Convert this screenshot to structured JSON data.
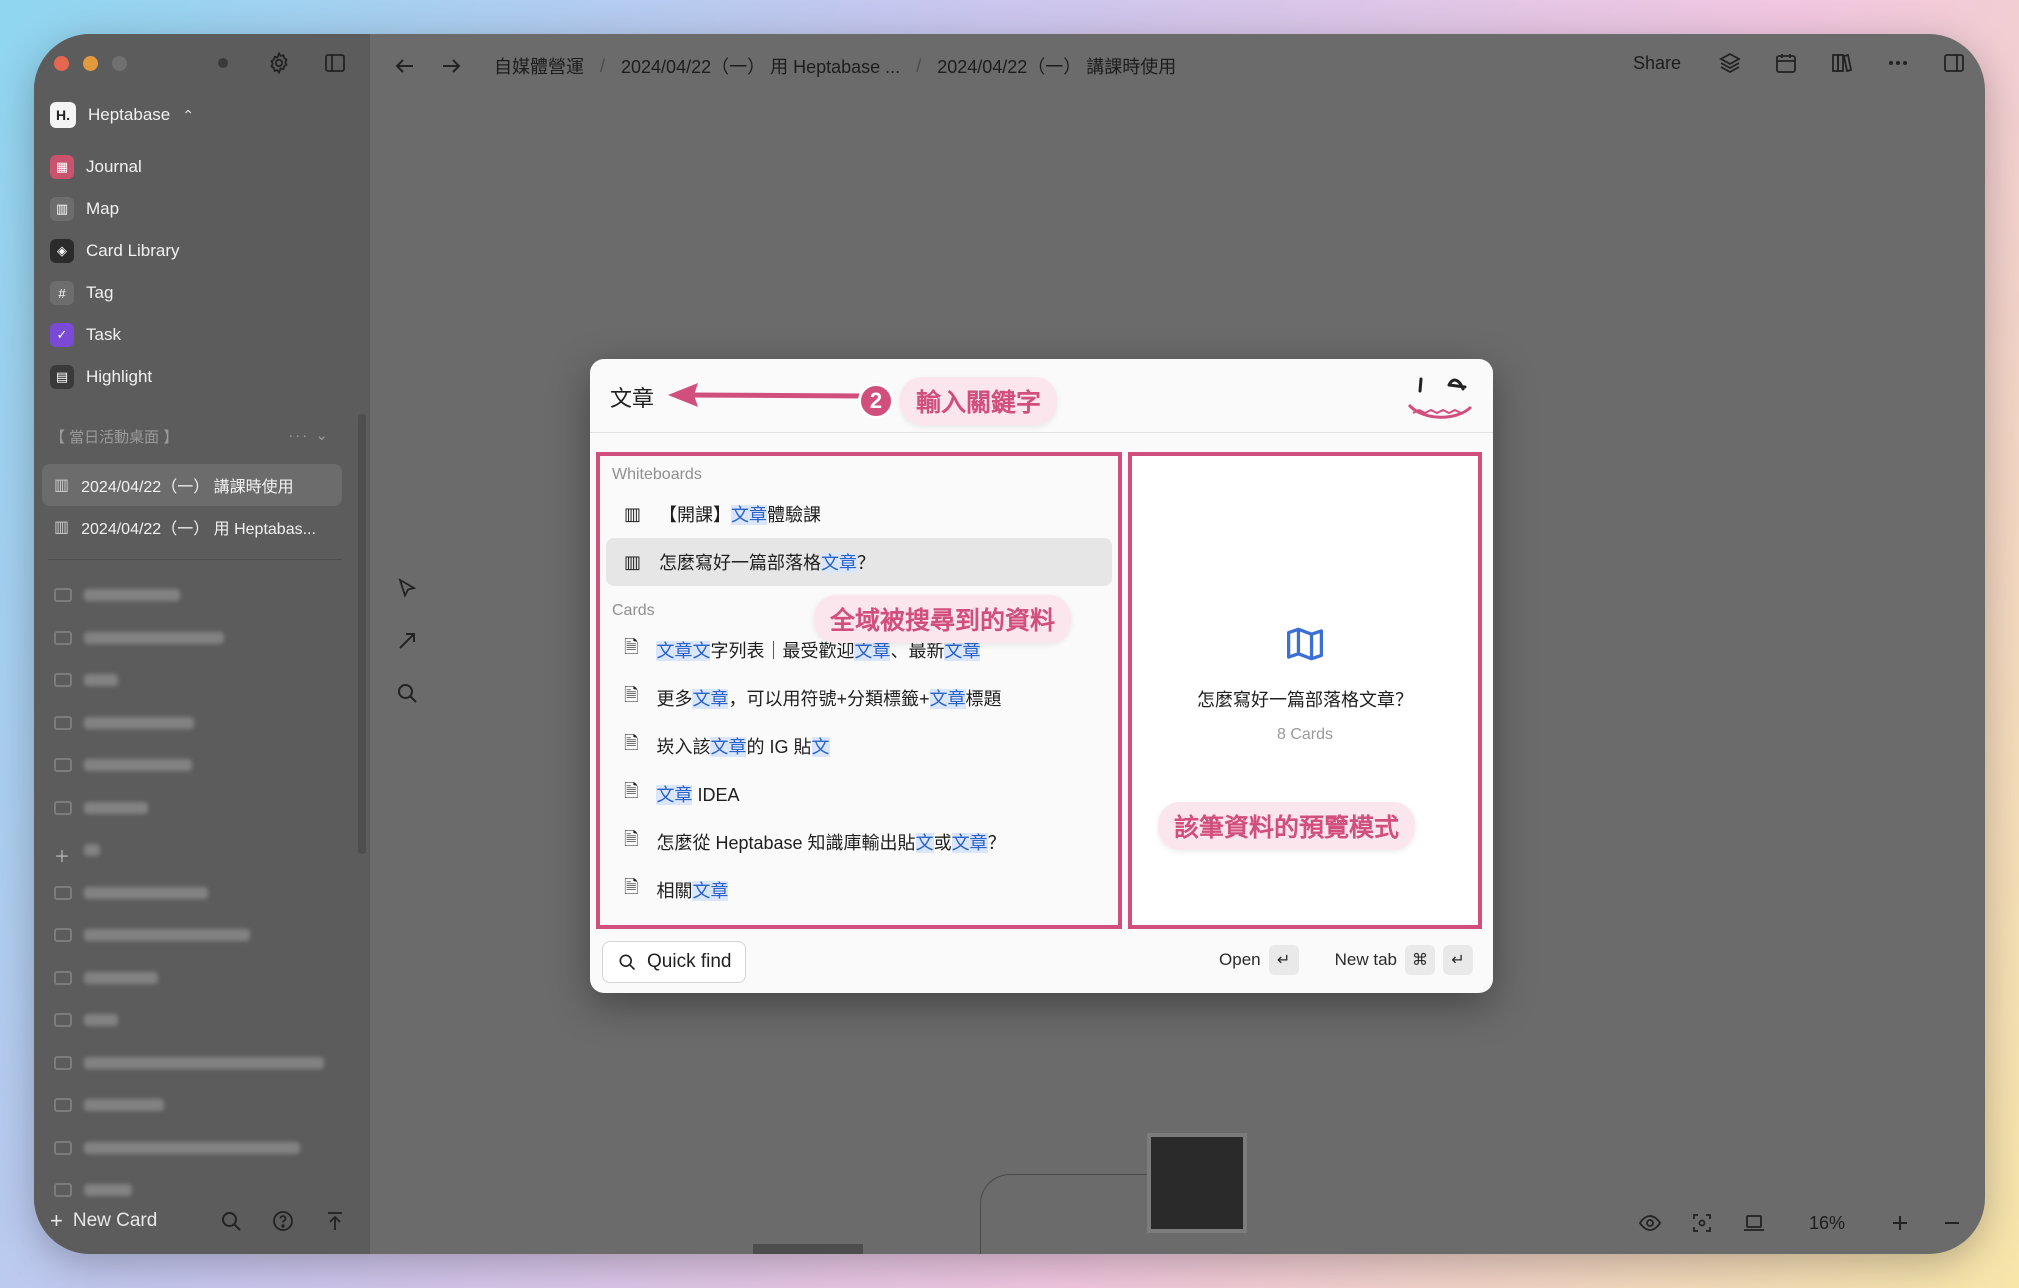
{
  "sidebar": {
    "workspace": "Heptabase",
    "workspace_logo": "H.",
    "nav": [
      {
        "label": "Journal",
        "icon": "calendar-icon",
        "color": "#c9536c"
      },
      {
        "label": "Map",
        "icon": "map-icon",
        "color": "#6d6d6d"
      },
      {
        "label": "Card Library",
        "icon": "layers-icon",
        "color": "#2b2b2b"
      },
      {
        "label": "Tag",
        "icon": "hash-icon",
        "color": "#6d6d6d"
      },
      {
        "label": "Task",
        "icon": "check-circle-icon",
        "color": "#7a4ad6"
      },
      {
        "label": "Highlight",
        "icon": "highlight-icon",
        "color": "#3a3a3a"
      }
    ],
    "section_title": "【 當日活動桌面 】",
    "recent": [
      {
        "label": "2024/04/22（一） 講課時使用"
      },
      {
        "label": "2024/04/22（一） 用 Heptabas..."
      }
    ],
    "new_card": "New Card"
  },
  "topbar": {
    "crumbs": [
      "自媒體營運",
      "2024/04/22（一） 用 Heptabase ...",
      "2024/04/22（一） 講課時使用"
    ],
    "share": "Share"
  },
  "canvas": {
    "zoom": "16%"
  },
  "modal": {
    "query": "文章",
    "annotation_step": "2",
    "annotation_keyword": "輸入關鍵字",
    "annotation_results": "全域被搜尋到的資料",
    "annotation_preview": "該筆資料的預覽模式",
    "whiteboards_label": "Whiteboards",
    "whiteboards": [
      {
        "parts": [
          "【開課】",
          "文章",
          "體驗課"
        ]
      },
      {
        "parts": [
          "怎麼寫好一篇部落格",
          "文章",
          "？"
        ]
      }
    ],
    "cards_label": "Cards",
    "cards": [
      {
        "parts": [
          "",
          "文章文",
          "字列表｜最受歡迎",
          "文章",
          "、最新",
          "文章",
          ""
        ]
      },
      {
        "parts": [
          "更多",
          "文章",
          "，可以用符號+分類標籤+",
          "文章",
          "標題"
        ]
      },
      {
        "parts": [
          "崁入該",
          "文章",
          "的 IG 貼",
          "文",
          ""
        ]
      },
      {
        "parts": [
          "",
          "文章",
          " IDEA"
        ]
      },
      {
        "parts": [
          "怎麼從 Heptabase 知識庫輸出貼",
          "文",
          "或",
          "文章",
          "？"
        ]
      },
      {
        "parts": [
          "相關",
          "文章",
          ""
        ]
      }
    ],
    "preview": {
      "title": "怎麼寫好一篇部落格文章？",
      "count": "8 Cards"
    },
    "quick_find": "Quick find",
    "open_label": "Open",
    "new_tab_label": "New tab",
    "enter_key": "↵",
    "cmd_key": "⌘"
  },
  "colors": {
    "accent": "#d14f7d",
    "highlight_bg": "#d9e6fb",
    "highlight_text": "#2a62c9"
  }
}
